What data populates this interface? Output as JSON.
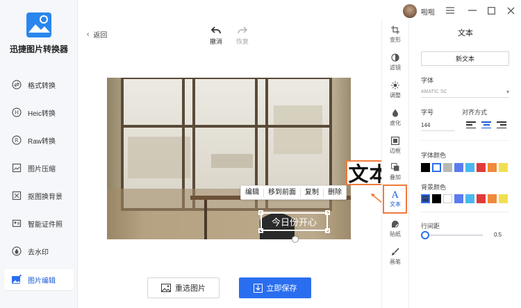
{
  "app": {
    "title": "迅捷图片转换器"
  },
  "sidebar": {
    "items": [
      {
        "label": "格式转换",
        "icon": "format-convert-icon"
      },
      {
        "label": "Heic转换",
        "icon": "heic-icon"
      },
      {
        "label": "Raw转换",
        "icon": "raw-icon"
      },
      {
        "label": "图片压缩",
        "icon": "compress-icon"
      },
      {
        "label": "抠图换背景",
        "icon": "cutout-icon"
      },
      {
        "label": "智能证件照",
        "icon": "id-photo-icon"
      },
      {
        "label": "去水印",
        "icon": "watermark-icon"
      },
      {
        "label": "图片编辑",
        "icon": "edit-image-icon",
        "active": true
      }
    ]
  },
  "topbar": {
    "back_label": "返回",
    "undo_label": "撤消",
    "redo_label": "恢复",
    "user_name": "啦啦"
  },
  "canvas": {
    "context_menu": [
      "编辑",
      "移到前面",
      "复制",
      "删除"
    ],
    "text_content": "今日份开心",
    "highlight_label": "文本"
  },
  "bottom": {
    "reselect_label": "重选图片",
    "save_label": "立即保存"
  },
  "tools": [
    {
      "label": "变形",
      "icon": "crop-icon"
    },
    {
      "label": "滤镜",
      "icon": "filter-icon"
    },
    {
      "label": "调整",
      "icon": "adjust-icon"
    },
    {
      "label": "虚化",
      "icon": "blur-icon"
    },
    {
      "label": "边框",
      "icon": "frame-icon"
    },
    {
      "label": "叠加",
      "icon": "overlay-icon"
    },
    {
      "label": "文本",
      "icon": "text-icon",
      "active": true
    },
    {
      "label": "贴纸",
      "icon": "sticker-icon"
    },
    {
      "label": "画笔",
      "icon": "brush-icon"
    }
  ],
  "panel": {
    "title": "文本",
    "new_text_label": "新文本",
    "font_label": "字体",
    "font_value": "AMATIC SC",
    "size_label": "字号",
    "size_value": "144",
    "align_label": "对齐方式",
    "font_color_label": "字体颜色",
    "bg_color_label": "背景颜色",
    "line_spacing_label": "行间距",
    "line_spacing_value": "0.5",
    "font_colors": [
      "#000000",
      "#ffffff",
      "#b8b8b8",
      "#5b7cf0",
      "#4ab8f0",
      "#e03b3b",
      "#f08a3a",
      "#f0e050"
    ],
    "bg_colors": [
      "#2a3a6a",
      "#000000",
      "#ffffff",
      "#5b7cf0",
      "#4ab8f0",
      "#e03b3b",
      "#f08a3a",
      "#f0e050"
    ]
  },
  "colors": {
    "accent": "#2a6ef0",
    "highlight": "#f07a3a"
  }
}
